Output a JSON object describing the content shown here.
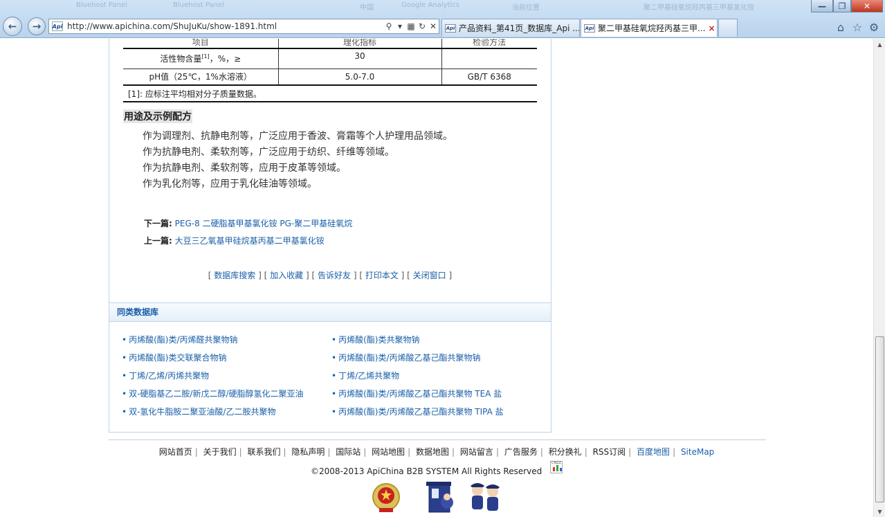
{
  "browser": {
    "address_url": "http://www.apichina.com/ShuJuKu/show-1891.html",
    "favicon_text": "Api",
    "tabs": [
      {
        "title": "产品资料_第41页_数据库_Api ..."
      },
      {
        "title": "聚二甲基硅氧烷羟丙基三甲..."
      }
    ],
    "ghost_tabs": [
      "Bluehost Panel",
      "Bluehost Panel",
      "中国",
      "Google Analytics",
      "当前位置",
      "聚二甲基硅氧烷羟丙基三甲基氯化铵"
    ]
  },
  "spec_table": {
    "headers": [
      "项目",
      "理化指标",
      "检验方法"
    ],
    "rows": [
      {
        "item": "活性物含量",
        "sup": "[1]",
        "unit": "，%，≥",
        "value": "30",
        "method": ""
      },
      {
        "item": "pH值（25℃，1%水溶液）",
        "value": "5.0-7.0",
        "method": "GB/T 6368"
      }
    ],
    "footnote": "[1]: 应标注平均相对分子质量数据。"
  },
  "usage": {
    "title": "用途及示例配方",
    "lines": [
      "作为调理剂、抗静电剂等，广泛应用于香波、膏霜等个人护理用品领域。",
      "作为抗静电剂、柔软剂等，广泛应用于纺织、纤维等领域。",
      "作为抗静电剂、柔软剂等，应用于皮革等领域。",
      "作为乳化剂等，应用于乳化硅油等领域。"
    ]
  },
  "related": {
    "next_label": "下一篇:",
    "next_title": "PEG-8 二硬脂基甲基氯化铵 PG-聚二甲基硅氧烷",
    "prev_label": "上一篇:",
    "prev_title": "大豆三乙氧基甲硅烷基丙基二甲基氯化铵"
  },
  "actions": [
    "数据库搜索",
    "加入收藏",
    "告诉好友",
    "打印本文",
    "关闭窗口"
  ],
  "similar": {
    "title": "同类数据库",
    "left": [
      "丙烯酸(酯)类/丙烯醛共聚物钠",
      "丙烯酸(酯)类交联聚合物钠",
      "丁烯/乙烯/丙烯共聚物",
      "双-硬脂基乙二胺/新戊二醇/硬脂醇氢化二聚亚油",
      "双-氢化牛脂胺二聚亚油酸/乙二胺共聚物"
    ],
    "right": [
      "丙烯酸(酯)类共聚物钠",
      "丙烯酸(酯)类/丙烯酸乙基己酯共聚物钠",
      "丁烯/乙烯共聚物",
      "丙烯酸(酯)类/丙烯酸乙基己酯共聚物 TEA 盐",
      "丙烯酸(酯)类/丙烯酸乙基己酯共聚物 TIPA 盐"
    ]
  },
  "footer": {
    "links": [
      "网站首页",
      "关于我们",
      "联系我们",
      "隐私声明",
      "国际站",
      "网站地图",
      "数据地图",
      "网站留言",
      "广告服务",
      "积分换礼",
      "RSS订阅"
    ],
    "highlight_links": [
      "百度地图",
      "SiteMap"
    ],
    "copyright": "©2008-2013 ApiChina B2B SYSTEM All Rights Reserved",
    "cnzz_label": "CNZZ"
  }
}
